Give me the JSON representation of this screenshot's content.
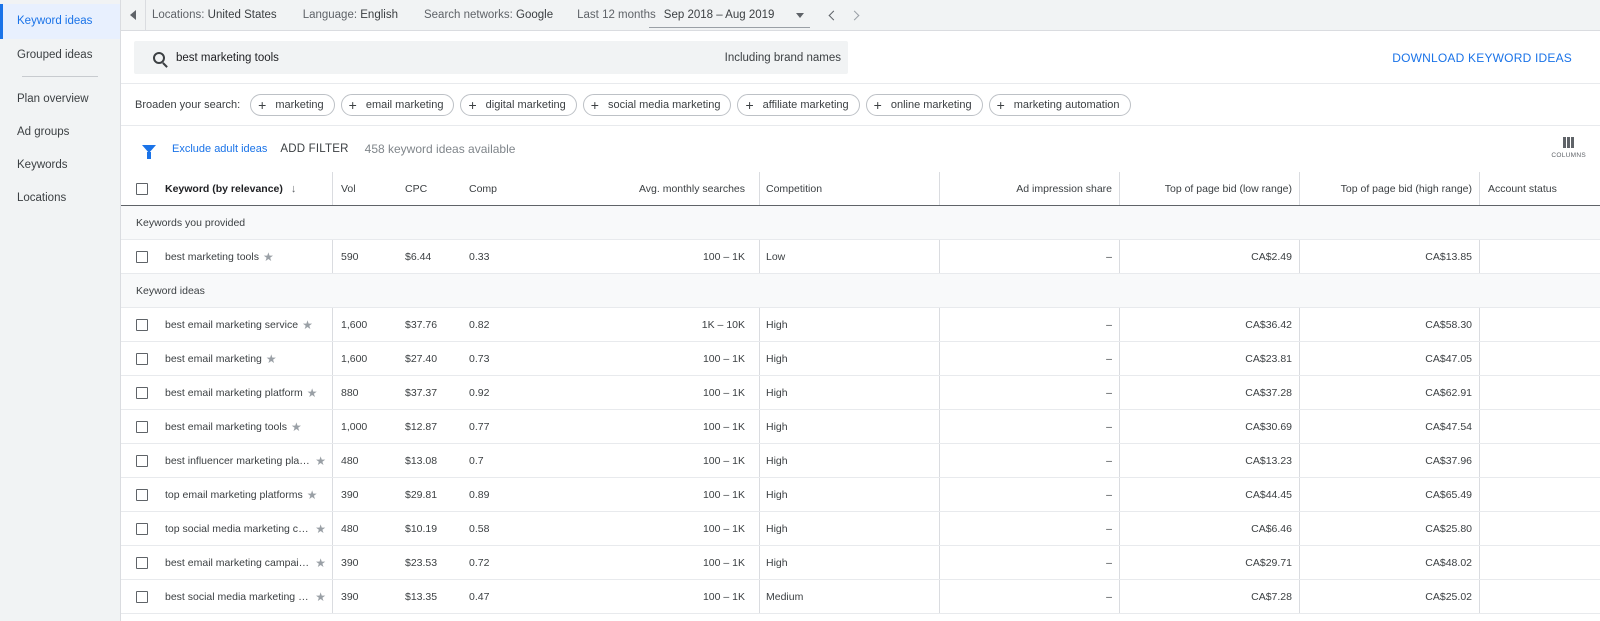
{
  "sidebar": {
    "items": [
      {
        "label": "Keyword ideas",
        "active": true
      },
      {
        "label": "Grouped ideas"
      },
      {
        "label": "Plan overview"
      },
      {
        "label": "Ad groups"
      },
      {
        "label": "Keywords"
      },
      {
        "label": "Locations"
      }
    ]
  },
  "topbar": {
    "locations_label": "Locations:",
    "locations_value": "United States",
    "language_label": "Language:",
    "language_value": "English",
    "networks_label": "Search networks:",
    "networks_value": "Google",
    "date_label": "Last 12 months",
    "date_value": "Sep 2018 – Aug 2019"
  },
  "search": {
    "query": "best marketing tools",
    "brand_toggle": "Including brand names",
    "download_label": "DOWNLOAD KEYWORD IDEAS"
  },
  "broaden": {
    "label": "Broaden your search:",
    "chips": [
      "marketing",
      "email marketing",
      "digital marketing",
      "social media marketing",
      "affiliate marketing",
      "online marketing",
      "marketing automation"
    ]
  },
  "filter": {
    "exclude_label": "Exclude adult ideas",
    "add_filter_label": "ADD FILTER",
    "available_text": "458 keyword ideas available",
    "columns_label": "COLUMNS"
  },
  "table": {
    "headers": {
      "keyword": "Keyword (by relevance)",
      "vol": "Vol",
      "cpc": "CPC",
      "comp": "Comp",
      "avg": "Avg. monthly searches",
      "competition": "Competition",
      "impression": "Ad impression share",
      "bid_low": "Top of page bid (low range)",
      "bid_high": "Top of page bid (high range)",
      "account": "Account status"
    },
    "section_provided": "Keywords you provided",
    "section_ideas": "Keyword ideas",
    "provided": [
      {
        "keyword": "best marketing tools",
        "vol": "590",
        "cpc": "$6.44",
        "comp": "0.33",
        "avg": "100 – 1K",
        "competition": "Low",
        "impression": "–",
        "bid_low": "CA$2.49",
        "bid_high": "CA$13.85"
      }
    ],
    "ideas": [
      {
        "keyword": "best email marketing service",
        "vol": "1,600",
        "cpc": "$37.76",
        "comp": "0.82",
        "avg": "1K – 10K",
        "competition": "High",
        "impression": "–",
        "bid_low": "CA$36.42",
        "bid_high": "CA$58.30"
      },
      {
        "keyword": "best email marketing",
        "vol": "1,600",
        "cpc": "$27.40",
        "comp": "0.73",
        "avg": "100 – 1K",
        "competition": "High",
        "impression": "–",
        "bid_low": "CA$23.81",
        "bid_high": "CA$47.05"
      },
      {
        "keyword": "best email marketing platform",
        "vol": "880",
        "cpc": "$37.37",
        "comp": "0.92",
        "avg": "100 – 1K",
        "competition": "High",
        "impression": "–",
        "bid_low": "CA$37.28",
        "bid_high": "CA$62.91"
      },
      {
        "keyword": "best email marketing tools",
        "vol": "1,000",
        "cpc": "$12.87",
        "comp": "0.77",
        "avg": "100 – 1K",
        "competition": "High",
        "impression": "–",
        "bid_low": "CA$30.69",
        "bid_high": "CA$47.54"
      },
      {
        "keyword": "best influencer marketing platfo…",
        "vol": "480",
        "cpc": "$13.08",
        "comp": "0.7",
        "avg": "100 – 1K",
        "competition": "High",
        "impression": "–",
        "bid_low": "CA$13.23",
        "bid_high": "CA$37.96"
      },
      {
        "keyword": "top email marketing platforms",
        "vol": "390",
        "cpc": "$29.81",
        "comp": "0.89",
        "avg": "100 – 1K",
        "competition": "High",
        "impression": "–",
        "bid_low": "CA$44.45",
        "bid_high": "CA$65.49"
      },
      {
        "keyword": "top social media marketing com…",
        "vol": "480",
        "cpc": "$10.19",
        "comp": "0.58",
        "avg": "100 – 1K",
        "competition": "High",
        "impression": "–",
        "bid_low": "CA$6.46",
        "bid_high": "CA$25.80"
      },
      {
        "keyword": "best email marketing campaigns",
        "vol": "390",
        "cpc": "$23.53",
        "comp": "0.72",
        "avg": "100 – 1K",
        "competition": "High",
        "impression": "–",
        "bid_low": "CA$29.71",
        "bid_high": "CA$48.02"
      },
      {
        "keyword": "best social media marketing co…",
        "vol": "390",
        "cpc": "$13.35",
        "comp": "0.47",
        "avg": "100 – 1K",
        "competition": "Medium",
        "impression": "–",
        "bid_low": "CA$7.28",
        "bid_high": "CA$25.02"
      }
    ]
  }
}
